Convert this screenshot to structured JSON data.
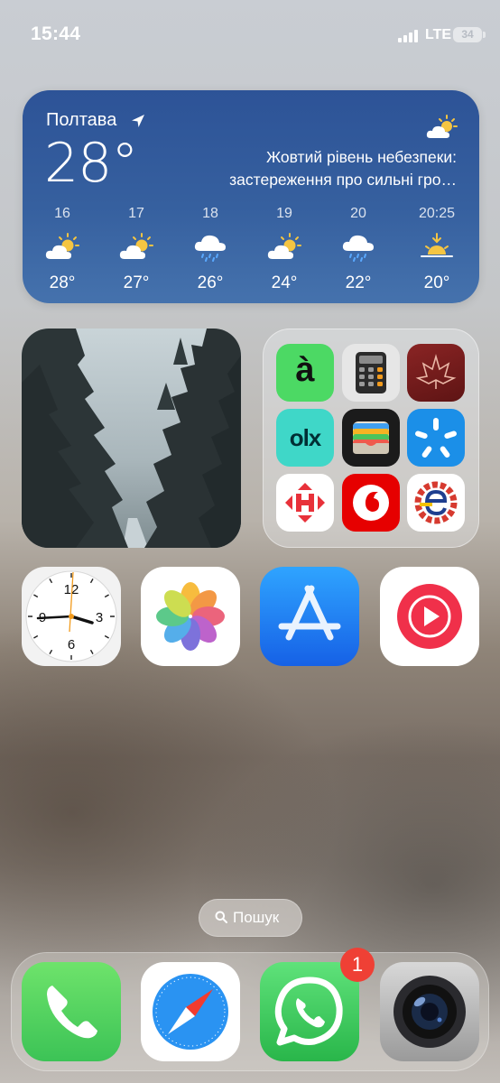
{
  "status_bar": {
    "time": "15:44",
    "network": "LTE",
    "battery": "34"
  },
  "weather": {
    "city": "Полтава",
    "temperature": "28°",
    "condition_icon": "partly-sunny-icon",
    "alert_line1": "Жовтий рівень небезпеки:",
    "alert_line2": "застереження про сильні гро…",
    "forecast": [
      {
        "time": "16",
        "icon": "partly-sunny-icon",
        "temp": "28°"
      },
      {
        "time": "17",
        "icon": "partly-sunny-icon",
        "temp": "27°"
      },
      {
        "time": "18",
        "icon": "rain-icon",
        "temp": "26°"
      },
      {
        "time": "19",
        "icon": "partly-sunny-icon",
        "temp": "24°"
      },
      {
        "time": "20",
        "icon": "rain-icon",
        "temp": "22°"
      },
      {
        "time": "20:25",
        "icon": "sunset-icon",
        "temp": "20°"
      }
    ]
  },
  "photo_widget": {
    "subject": "fir-trees-photo"
  },
  "folder_apps": [
    {
      "icon": "a-green-app-icon",
      "glyph": "à",
      "color": "#4cd964"
    },
    {
      "icon": "calculator-icon",
      "color": "#e7e7e7"
    },
    {
      "icon": "maple-leaf-app-icon",
      "color": "#7c1f1f"
    },
    {
      "icon": "olx-app-icon",
      "glyph": "olx",
      "color": "#3bd6c6"
    },
    {
      "icon": "wallet-icon",
      "color": "#1b1b1b"
    },
    {
      "icon": "kyivstar-icon",
      "color": "#1a8fe8"
    },
    {
      "icon": "nova-poshta-icon",
      "color": "#ffffff"
    },
    {
      "icon": "vodafone-icon",
      "color": "#e60000"
    },
    {
      "icon": "e-gear-app-icon",
      "color": "#ffffff"
    }
  ],
  "home_apps": [
    {
      "icon": "clock-icon",
      "clock_numbers": [
        "12",
        "3",
        "6",
        "9"
      ]
    },
    {
      "icon": "photos-icon"
    },
    {
      "icon": "app-store-icon",
      "color": "#1a78f2"
    },
    {
      "icon": "youtube-music-icon",
      "color": "#f0304a"
    }
  ],
  "search": {
    "label": "Пошук"
  },
  "dock": [
    {
      "icon": "phone-icon",
      "color": "#4cd964"
    },
    {
      "icon": "safari-icon",
      "color": "#1f8cf0"
    },
    {
      "icon": "whatsapp-icon",
      "color": "#34c759",
      "badge": "1"
    },
    {
      "icon": "camera-icon",
      "color": "#9a9a9a"
    }
  ]
}
